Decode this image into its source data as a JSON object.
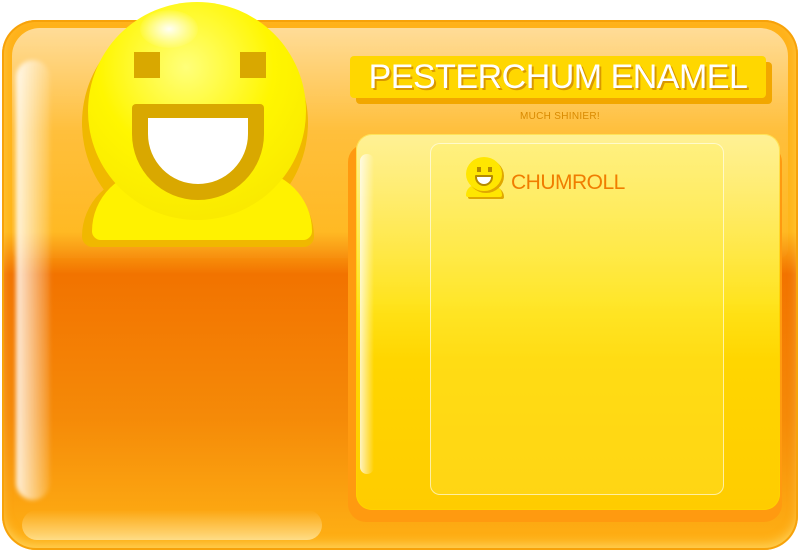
{
  "window": {
    "title": "PESTERCHUM ENAMEL",
    "subtitle": "MUCH SHINIER!"
  },
  "chumroll": {
    "label": "CHUMROLL",
    "chums": []
  },
  "theme": {
    "frame_orange": "#f27300",
    "frame_gold": "#ffb21a",
    "panel_yellow": "#ffe319",
    "accent_text": "#f07d00",
    "mascot_yellow": "#fff600"
  },
  "icons": {
    "mascot": "pesterchum-smiley-icon",
    "chumroll": "chumroll-smiley-icon"
  }
}
